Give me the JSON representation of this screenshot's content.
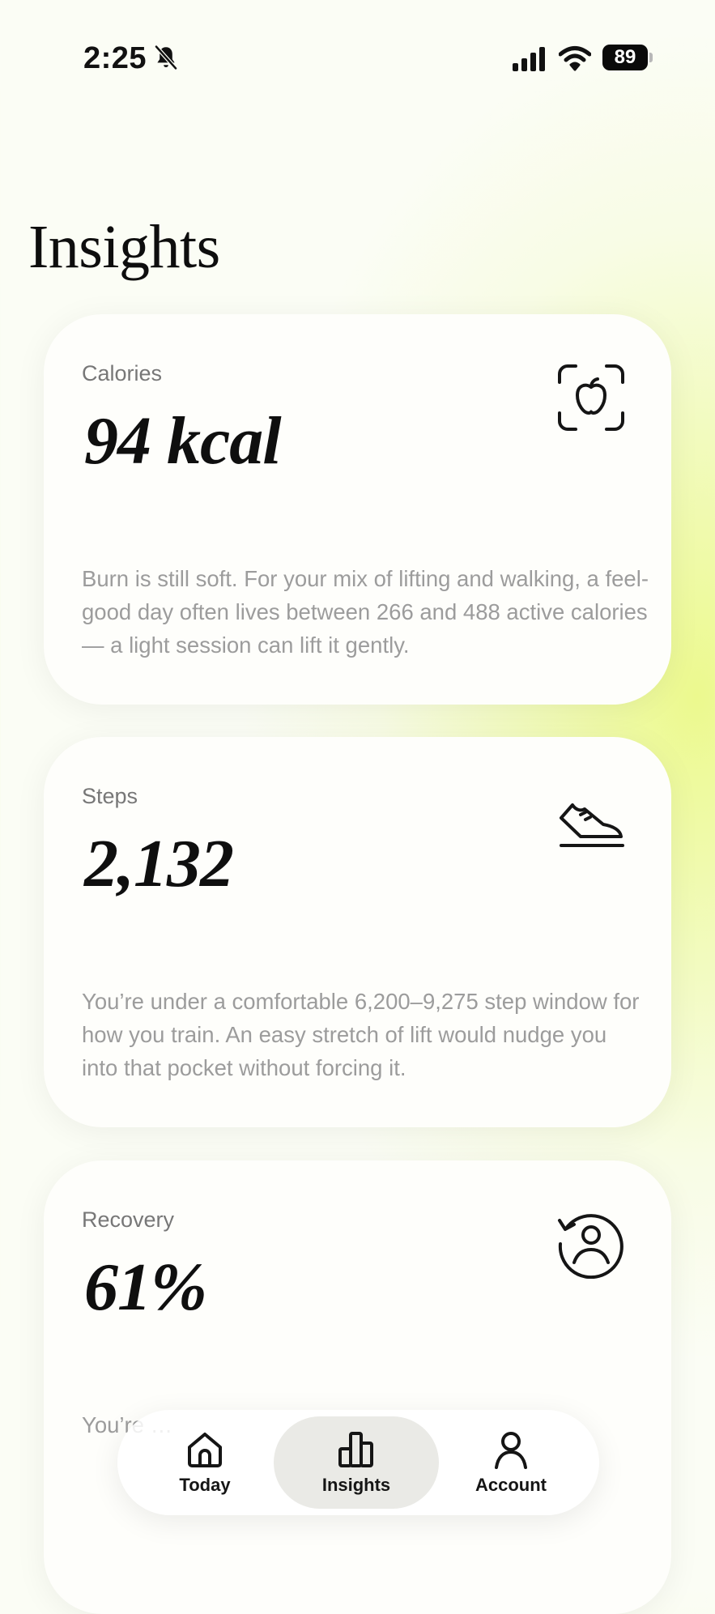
{
  "status_bar": {
    "time": "2:25",
    "battery": "89"
  },
  "page": {
    "title": "Insights"
  },
  "cards": [
    {
      "label": "Calories",
      "value": "94 kcal",
      "icon": "apple-scan-icon",
      "body": "Burn is still soft. For your mix of lifting and walking, a feel-good day often lives between 266 and 488 active calories — a light session can lift it gently."
    },
    {
      "label": "Steps",
      "value": "2,132",
      "icon": "sneaker-icon",
      "body": "You’re under a comfortable 6,200–9,275 step window for how you train. An easy stretch of lift would nudge you into that pocket without forcing it."
    },
    {
      "label": "Recovery",
      "value": "61%",
      "icon": "person-refresh-icon",
      "body": "You’re …"
    }
  ],
  "nav": {
    "active": "Insights",
    "items": [
      {
        "label": "Today",
        "icon": "home-icon"
      },
      {
        "label": "Insights",
        "icon": "bar-chart-icon"
      },
      {
        "label": "Account",
        "icon": "person-icon"
      }
    ]
  }
}
